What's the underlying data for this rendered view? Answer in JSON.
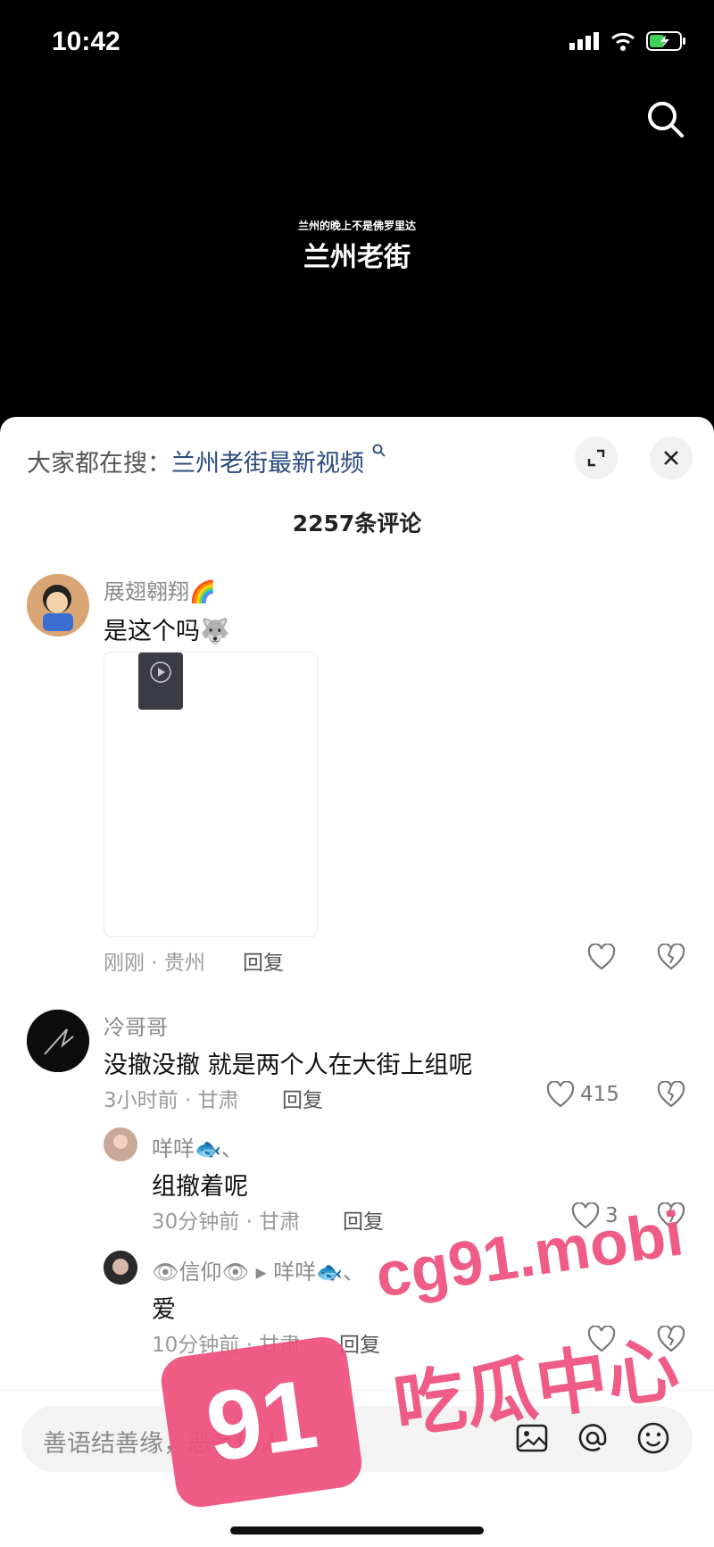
{
  "status_bar": {
    "time": "10:42"
  },
  "video": {
    "subtitle": "兰州的晚上不是佛罗里达",
    "title": "兰州老街"
  },
  "sheet": {
    "hot_search_prefix": "大家都在搜：",
    "hot_search_link": "兰州老街最新视频",
    "comment_count": "2257条评论"
  },
  "comments": [
    {
      "user": "展翅翱翔🌈",
      "text": "是这个吗🐺",
      "time_loc": "刚刚 · 贵州",
      "reply": "回复",
      "likes": ""
    },
    {
      "user": "冷哥哥",
      "text": "没撤没撤 就是两个人在大街上组呢",
      "time_loc": "3小时前 · 甘肃",
      "reply": "回复",
      "likes": "415"
    },
    {
      "user": "咩咩🐟、",
      "text": "组撤着呢",
      "time_loc": "30分钟前 · 甘肃",
      "reply": "回复",
      "likes": "3"
    },
    {
      "user": "👁信仰👁 ▸ 咩咩🐟、",
      "text": "爱",
      "time_loc": "10分钟前 · 甘肃",
      "reply": "回复",
      "likes": ""
    }
  ],
  "input": {
    "placeholder": "善语结善缘，恶言伤人心"
  },
  "watermark": {
    "badge": "91",
    "url": "cg91.mobi",
    "caption": "吃瓜中心"
  },
  "colors": {
    "link": "#2a4a7d",
    "watermark": "#ee4f7c"
  },
  "icons": [
    "search-icon",
    "expand-icon",
    "close-icon",
    "heart-icon",
    "dislike-icon",
    "image-icon",
    "at-icon",
    "emoji-icon"
  ]
}
